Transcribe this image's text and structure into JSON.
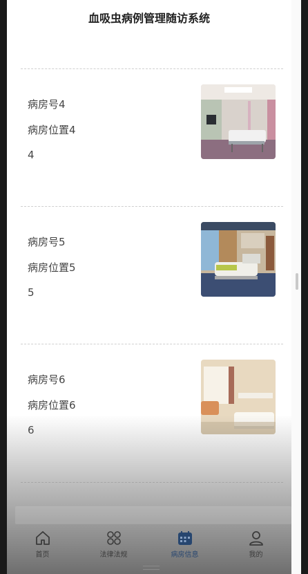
{
  "app": {
    "title": "血吸虫病例管理随访系统"
  },
  "rooms": [
    {
      "name": "病房号4",
      "location": "病房位置4",
      "value": "4",
      "photo_icon": "hospital-room-photo"
    },
    {
      "name": "病房号5",
      "location": "病房位置5",
      "value": "5",
      "photo_icon": "hospital-room-photo"
    },
    {
      "name": "病房号6",
      "location": "病房位置6",
      "value": "6",
      "photo_icon": "hospital-room-photo"
    }
  ],
  "tabs": [
    {
      "label": "首页",
      "icon": "home-icon"
    },
    {
      "label": "法律法规",
      "icon": "grid-circles-icon"
    },
    {
      "label": "病房信息",
      "icon": "calendar-icon",
      "active": true
    },
    {
      "label": "我的",
      "icon": "user-icon"
    }
  ],
  "colors": {
    "active_tab": "#27466f",
    "text": "#444444"
  }
}
